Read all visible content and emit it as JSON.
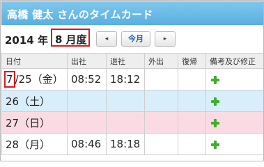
{
  "header": {
    "title": "高橋 健太 さんのタイムカード"
  },
  "nav": {
    "year": "2014 年",
    "month": "8 月度",
    "prev_label": "◂",
    "today_label": "今月",
    "next_label": "▸"
  },
  "table": {
    "columns": [
      "日付",
      "出社",
      "退社",
      "外出",
      "復帰",
      "備考及び修正"
    ],
    "rows": [
      {
        "date_prefix": "7",
        "date_rest": "/25（金）",
        "clock_in": "08:52",
        "clock_out": "18:12",
        "away": "",
        "back": "",
        "kind": "weekday"
      },
      {
        "date": "26（土）",
        "clock_in": "",
        "clock_out": "",
        "away": "",
        "back": "",
        "kind": "saturday"
      },
      {
        "date": "27（日）",
        "clock_in": "",
        "clock_out": "",
        "away": "",
        "back": "",
        "kind": "sunday"
      },
      {
        "date": "28（月）",
        "clock_in": "08:46",
        "clock_out": "18:18",
        "away": "",
        "back": "",
        "kind": "weekday"
      }
    ]
  },
  "icons": {
    "edit": "plus-icon",
    "prev": "triangle-left-icon",
    "next": "triangle-right-icon"
  },
  "colors": {
    "header_blue": "#5aafe0",
    "saturday_bg": "#d9eefb",
    "sunday_bg": "#fbdbe3",
    "highlight_red": "#d81b1b",
    "plus_green": "#3fae2a",
    "today_text": "#1f63b5"
  }
}
